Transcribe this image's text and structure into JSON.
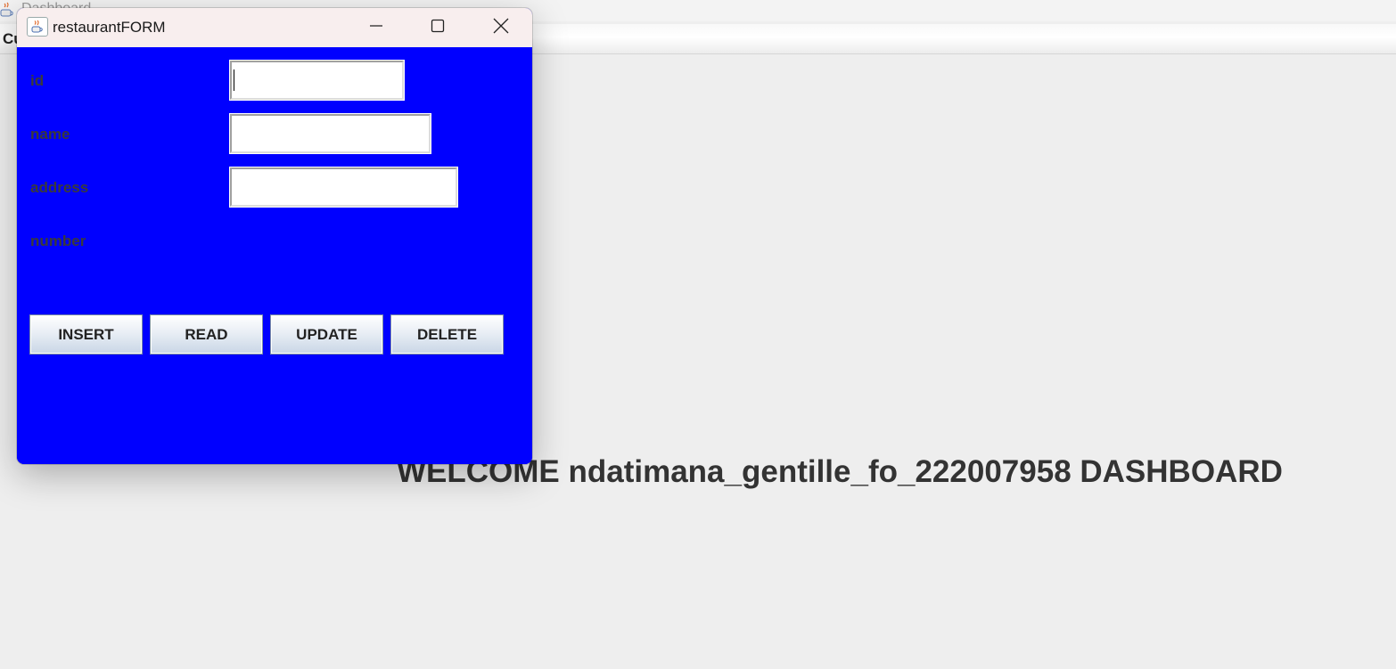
{
  "background_window": {
    "title": "Dashboard",
    "menu_item": "Cu",
    "welcome_text": "WELCOME ndatimana_gentille_fo_222007958 DASHBOARD"
  },
  "form_window": {
    "title": "restaurantFORM",
    "fields": [
      {
        "label": "id",
        "value": ""
      },
      {
        "label": "name",
        "value": ""
      },
      {
        "label": "address",
        "value": ""
      },
      {
        "label": "number"
      }
    ],
    "buttons": {
      "insert": "INSERT",
      "read": "READ",
      "update": "UPDATE",
      "delete": "DELETE"
    }
  },
  "colors": {
    "form_background": "#0000ff",
    "desktop_background": "#eeeeee",
    "label_text": "#3a3a3a"
  },
  "icons": [
    "java-app-icon",
    "minimize-icon",
    "maximize-icon",
    "close-icon"
  ]
}
